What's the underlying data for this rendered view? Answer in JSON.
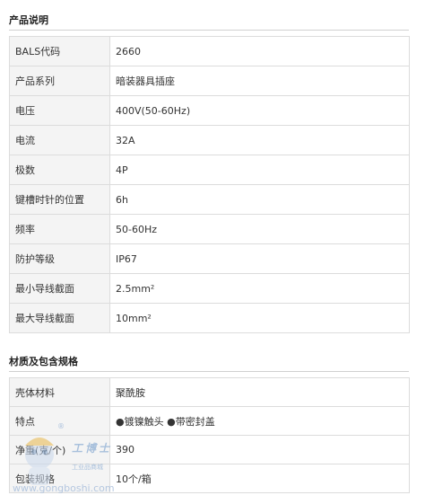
{
  "section1": {
    "title": "产品说明",
    "rows": [
      {
        "label": "BALS代码",
        "value": "2660"
      },
      {
        "label": "产品系列",
        "value": "暗装器具插座"
      },
      {
        "label": "电压",
        "value": "400V(50-60Hz)"
      },
      {
        "label": "电流",
        "value": "32A"
      },
      {
        "label": "极数",
        "value": "4P"
      },
      {
        "label": "键槽时针的位置",
        "value": "6h"
      },
      {
        "label": "频率",
        "value": "50-60Hz"
      },
      {
        "label": "防护等级",
        "value": "IP67"
      },
      {
        "label": "最小导线截面",
        "value": "2.5mm²"
      },
      {
        "label": "最大导线截面",
        "value": "10mm²"
      }
    ]
  },
  "section2": {
    "title": "材质及包含规格",
    "rows": [
      {
        "label": "壳体材料",
        "value": "聚酰胺"
      },
      {
        "label": "特点",
        "value": "●镀镍触头 ●带密封盖"
      },
      {
        "label": "净重(克/个)",
        "value": "390"
      },
      {
        "label": "包装规格",
        "value": "10个/箱"
      }
    ]
  },
  "watermark": {
    "brand": "工博士",
    "subtitle": "工业品商城",
    "url": "www.gongboshi.com",
    "registered": "®",
    "accent": "#9bb7d8"
  }
}
